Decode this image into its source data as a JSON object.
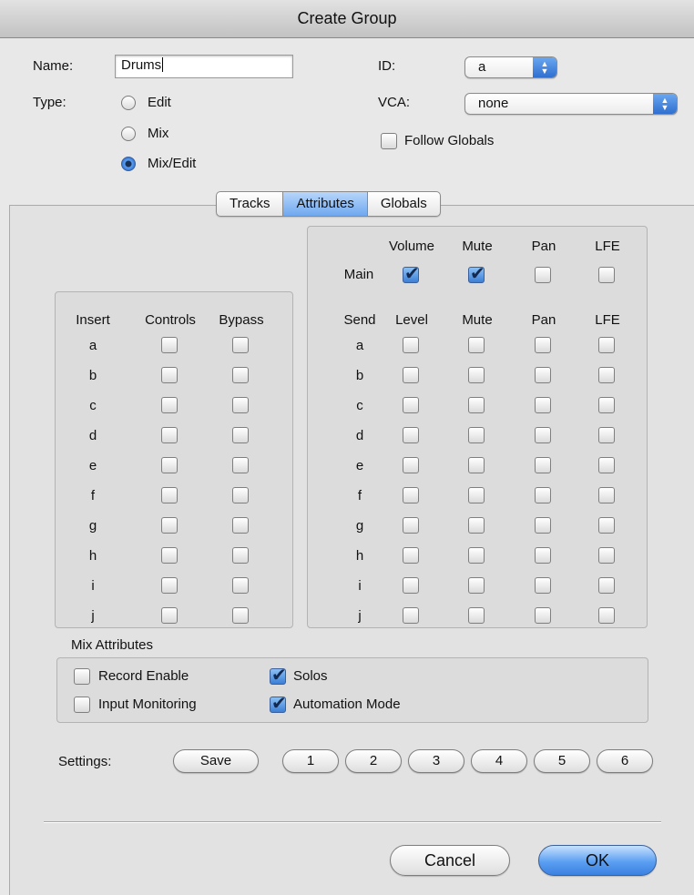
{
  "window": {
    "title": "Create Group"
  },
  "form": {
    "name_label": "Name:",
    "name_value": "Drums",
    "type_label": "Type:",
    "types": [
      {
        "label": "Edit",
        "selected": false
      },
      {
        "label": "Mix",
        "selected": false
      },
      {
        "label": "Mix/Edit",
        "selected": true
      }
    ],
    "id_label": "ID:",
    "id_value": "a",
    "vca_label": "VCA:",
    "vca_value": "none",
    "follow_globals_label": "Follow Globals",
    "follow_globals_checked": false
  },
  "tabs": [
    {
      "label": "Tracks",
      "active": false
    },
    {
      "label": "Attributes",
      "active": true
    },
    {
      "label": "Globals",
      "active": false
    }
  ],
  "inserts": {
    "headers": [
      "Insert",
      "Controls",
      "Bypass"
    ],
    "rows": [
      {
        "label": "a",
        "controls": false,
        "bypass": false
      },
      {
        "label": "b",
        "controls": false,
        "bypass": false
      },
      {
        "label": "c",
        "controls": false,
        "bypass": false
      },
      {
        "label": "d",
        "controls": false,
        "bypass": false
      },
      {
        "label": "e",
        "controls": false,
        "bypass": false
      },
      {
        "label": "f",
        "controls": false,
        "bypass": false
      },
      {
        "label": "g",
        "controls": false,
        "bypass": false
      },
      {
        "label": "h",
        "controls": false,
        "bypass": false
      },
      {
        "label": "i",
        "controls": false,
        "bypass": false
      },
      {
        "label": "j",
        "controls": false,
        "bypass": false
      }
    ]
  },
  "main": {
    "label": "Main",
    "headers": [
      "Volume",
      "Mute",
      "Pan",
      "LFE"
    ],
    "values": [
      true,
      true,
      false,
      false
    ]
  },
  "sends": {
    "headers": [
      "Send",
      "Level",
      "Mute",
      "Pan",
      "LFE"
    ],
    "rows": [
      {
        "label": "a",
        "values": [
          false,
          false,
          false,
          false
        ]
      },
      {
        "label": "b",
        "values": [
          false,
          false,
          false,
          false
        ]
      },
      {
        "label": "c",
        "values": [
          false,
          false,
          false,
          false
        ]
      },
      {
        "label": "d",
        "values": [
          false,
          false,
          false,
          false
        ]
      },
      {
        "label": "e",
        "values": [
          false,
          false,
          false,
          false
        ]
      },
      {
        "label": "f",
        "values": [
          false,
          false,
          false,
          false
        ]
      },
      {
        "label": "g",
        "values": [
          false,
          false,
          false,
          false
        ]
      },
      {
        "label": "h",
        "values": [
          false,
          false,
          false,
          false
        ]
      },
      {
        "label": "i",
        "values": [
          false,
          false,
          false,
          false
        ]
      },
      {
        "label": "j",
        "values": [
          false,
          false,
          false,
          false
        ]
      }
    ]
  },
  "mix_attributes": {
    "title": "Mix Attributes",
    "items": [
      {
        "label": "Record Enable",
        "checked": false
      },
      {
        "label": "Input Monitoring",
        "checked": false
      },
      {
        "label": "Solos",
        "checked": true
      },
      {
        "label": "Automation Mode",
        "checked": true
      }
    ]
  },
  "settings": {
    "label": "Settings:",
    "save_label": "Save",
    "slots": [
      "1",
      "2",
      "3",
      "4",
      "5",
      "6"
    ]
  },
  "buttons": {
    "cancel": "Cancel",
    "ok": "OK"
  },
  "colors": {
    "accent": "#3a81e0",
    "active_tab": "#6fa8ef"
  }
}
